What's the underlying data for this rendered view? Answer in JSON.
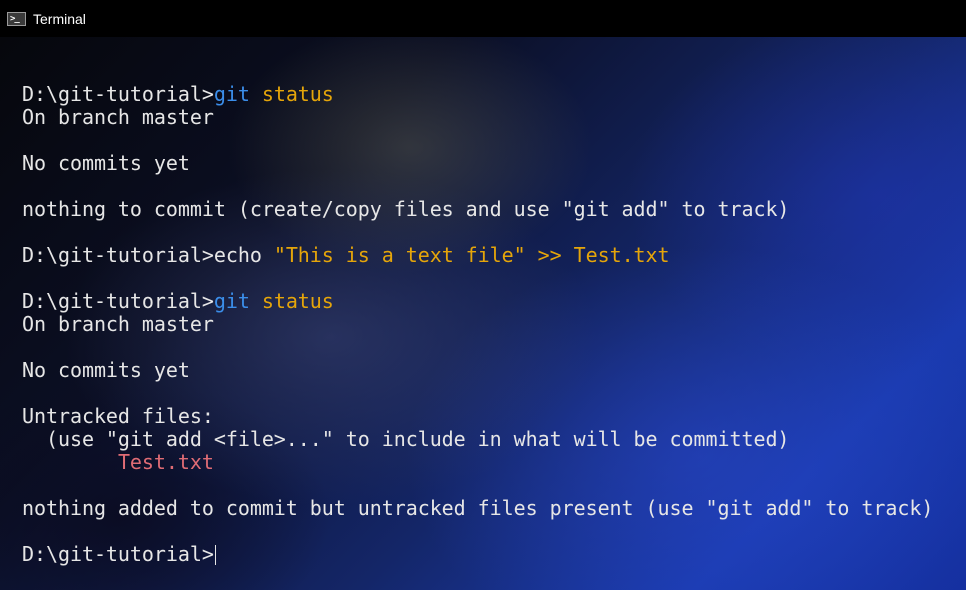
{
  "window": {
    "title": "Terminal",
    "icon": "terminal-icon",
    "icon_glyph": ">_"
  },
  "colors": {
    "command": "#3b8eea",
    "argument": "#e5a50a",
    "untracked": "#e06c75",
    "text": "#e6e6e6"
  },
  "console": {
    "lines": [
      {
        "prompt": "D:\\git-tutorial>",
        "cmd": "git",
        "arg": " status"
      },
      {
        "text": "On branch master"
      },
      {
        "text": ""
      },
      {
        "text": "No commits yet"
      },
      {
        "text": ""
      },
      {
        "text": "nothing to commit (create/copy files and use \"git add\" to track)"
      },
      {
        "text": ""
      },
      {
        "prompt": "D:\\git-tutorial>",
        "plain": "echo ",
        "arg": "\"This is a text file\" >> Test.txt"
      },
      {
        "text": ""
      },
      {
        "prompt": "D:\\git-tutorial>",
        "cmd": "git",
        "arg": " status"
      },
      {
        "text": "On branch master"
      },
      {
        "text": ""
      },
      {
        "text": "No commits yet"
      },
      {
        "text": ""
      },
      {
        "text": "Untracked files:"
      },
      {
        "text": "  (use \"git add <file>...\" to include in what will be committed)"
      },
      {
        "indent": "        ",
        "untracked": "Test.txt"
      },
      {
        "text": ""
      },
      {
        "text": "nothing added to commit but untracked files present (use \"git add\" to track)"
      },
      {
        "text": ""
      },
      {
        "prompt": "D:\\git-tutorial>",
        "cursor": true
      }
    ]
  }
}
